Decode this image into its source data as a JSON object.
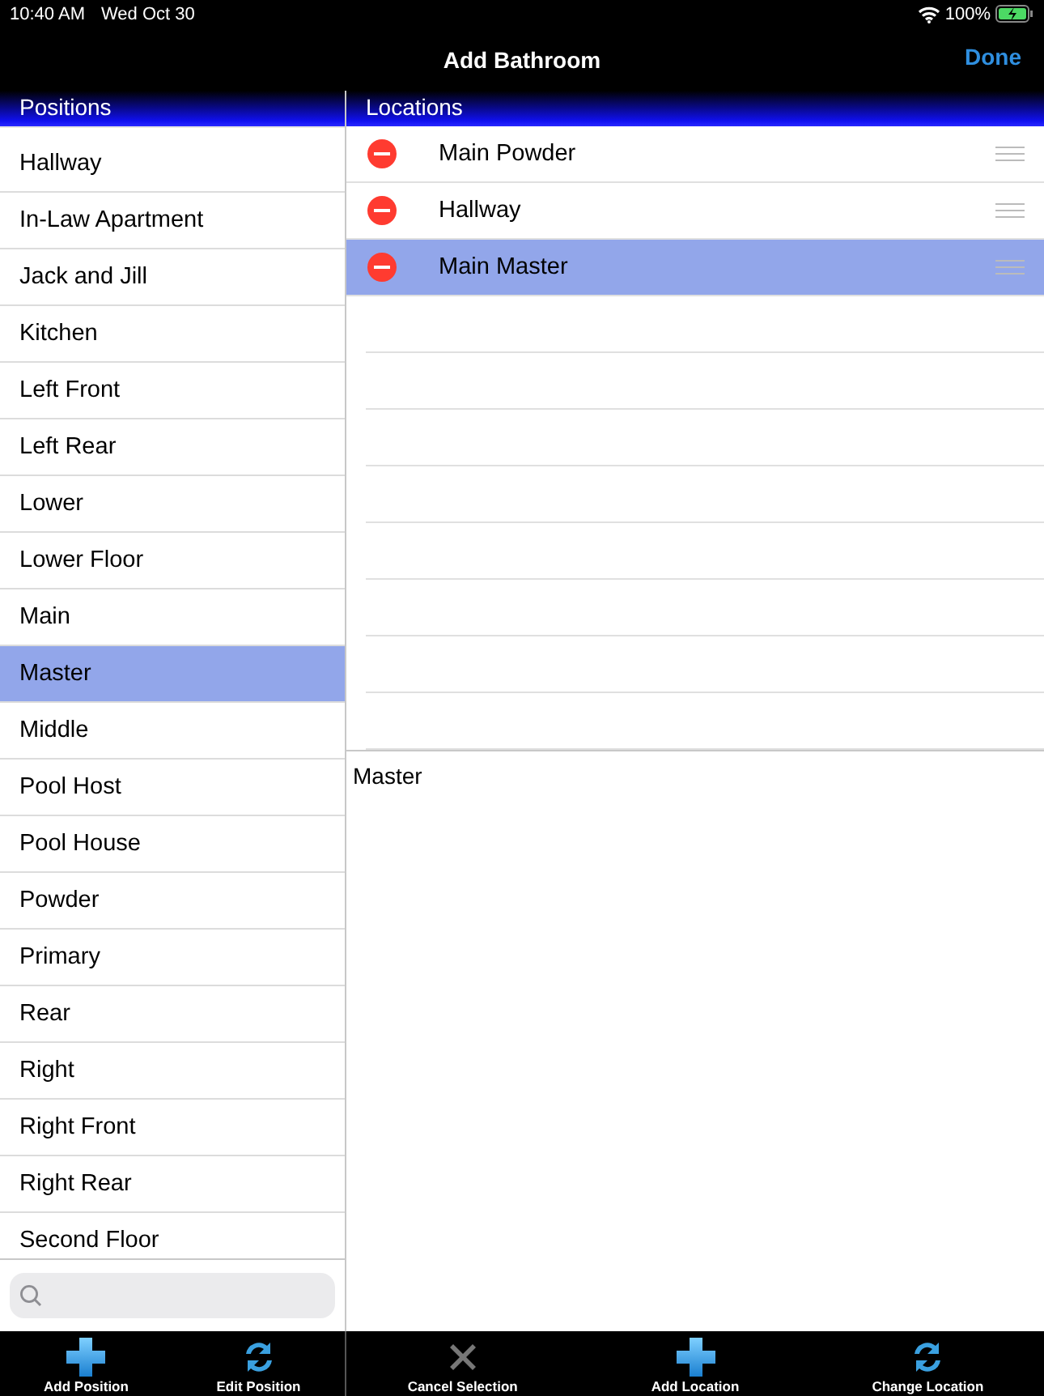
{
  "status_bar": {
    "time": "10:40 AM",
    "date": "Wed Oct 30",
    "battery": "100%"
  },
  "nav": {
    "title": "Add Bathroom",
    "done": "Done"
  },
  "positions": {
    "header": "Positions",
    "items": [
      {
        "label": "Hallway",
        "selected": false
      },
      {
        "label": "In-Law Apartment",
        "selected": false
      },
      {
        "label": "Jack and Jill",
        "selected": false
      },
      {
        "label": "Kitchen",
        "selected": false
      },
      {
        "label": "Left Front",
        "selected": false
      },
      {
        "label": "Left Rear",
        "selected": false
      },
      {
        "label": "Lower",
        "selected": false
      },
      {
        "label": "Lower Floor",
        "selected": false
      },
      {
        "label": "Main",
        "selected": false
      },
      {
        "label": "Master",
        "selected": true
      },
      {
        "label": "Middle",
        "selected": false
      },
      {
        "label": "Pool Host",
        "selected": false
      },
      {
        "label": "Pool House",
        "selected": false
      },
      {
        "label": "Powder",
        "selected": false
      },
      {
        "label": "Primary",
        "selected": false
      },
      {
        "label": "Rear",
        "selected": false
      },
      {
        "label": "Right",
        "selected": false
      },
      {
        "label": "Right Front",
        "selected": false
      },
      {
        "label": "Right Rear",
        "selected": false
      },
      {
        "label": "Second Floor",
        "selected": false
      }
    ]
  },
  "locations": {
    "header": "Locations",
    "items": [
      {
        "label": "Main Powder",
        "selected": false
      },
      {
        "label": "Hallway",
        "selected": false
      },
      {
        "label": "Main Master",
        "selected": true
      }
    ]
  },
  "detail": {
    "text": "Master"
  },
  "left_toolbar": [
    {
      "kind": "plus",
      "label": "Add Position"
    },
    {
      "kind": "refresh",
      "label": "Edit Position"
    }
  ],
  "right_toolbar": [
    {
      "kind": "cross",
      "label": "Cancel Selection"
    },
    {
      "kind": "plus",
      "label": "Add Location"
    },
    {
      "kind": "refresh",
      "label": "Change Location"
    }
  ]
}
